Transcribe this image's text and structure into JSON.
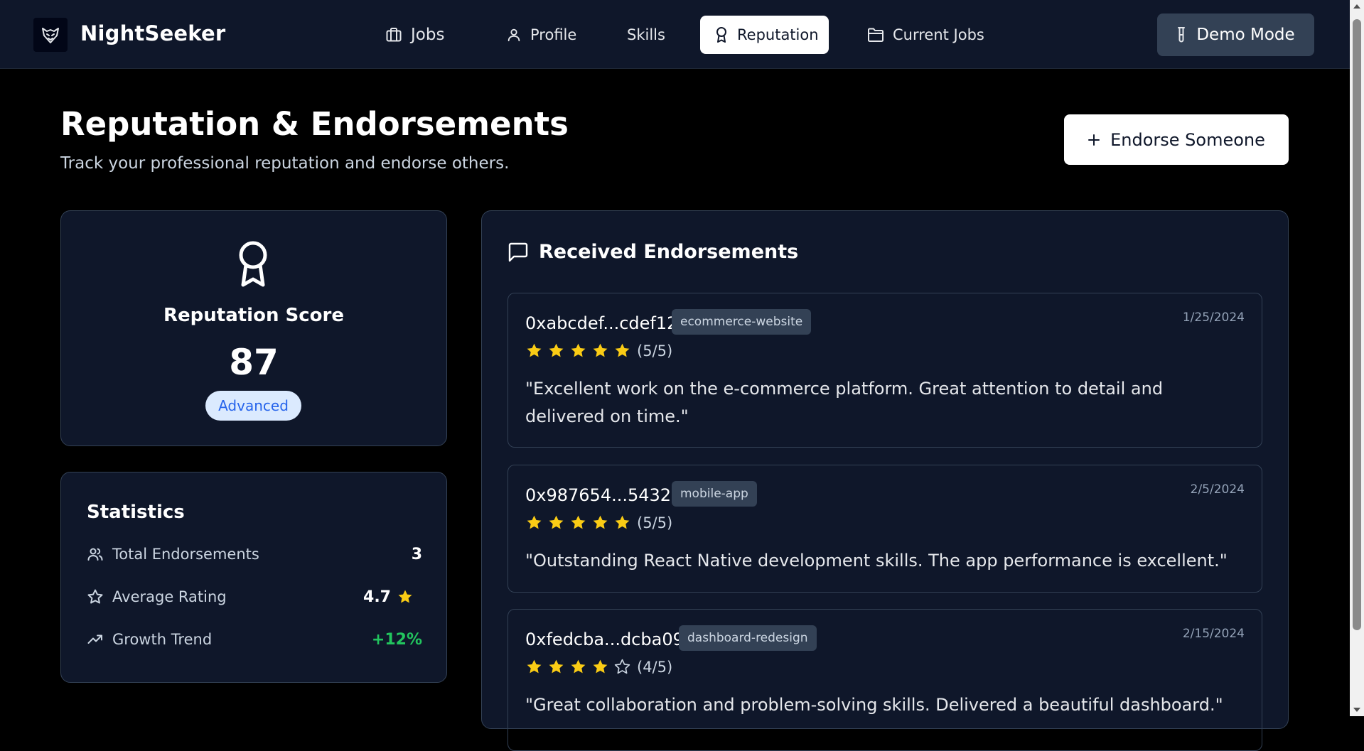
{
  "nav": {
    "brand": "NightSeeker",
    "items": [
      {
        "label": "Jobs",
        "icon": "briefcase-icon"
      },
      {
        "label": "Profile",
        "icon": "user-icon"
      },
      {
        "label": "Skills",
        "icon": ""
      },
      {
        "label": "Reputation",
        "icon": "award-icon",
        "active": true
      },
      {
        "label": "Current Jobs",
        "icon": "folder-icon"
      }
    ],
    "demo_label": "Demo Mode"
  },
  "page": {
    "title": "Reputation & Endorsements",
    "subtitle": "Track your professional reputation and endorse others.",
    "endorse_button": "Endorse Someone"
  },
  "score": {
    "label": "Reputation Score",
    "value": "87",
    "level": "Advanced"
  },
  "statistics": {
    "title": "Statistics",
    "rows": [
      {
        "label": "Total Endorsements",
        "value": "3",
        "icon": "users-icon"
      },
      {
        "label": "Average Rating",
        "value": "4.7",
        "icon": "star-outline-icon"
      },
      {
        "label": "Growth Trend",
        "value": "+12%",
        "icon": "trending-up-icon"
      }
    ]
  },
  "endorsements": {
    "title": "Received Endorsements",
    "items": [
      {
        "address": "0xabcdef...cdef12",
        "tag": "ecommerce-website",
        "date": "1/25/2024",
        "rating": 5,
        "rating_text": "(5/5)",
        "comment": "\"Excellent work on the e-commerce platform. Great attention to detail and delivered on time.\""
      },
      {
        "address": "0x987654...543210",
        "tag": "mobile-app",
        "date": "2/5/2024",
        "rating": 5,
        "rating_text": "(5/5)",
        "comment": "\"Outstanding React Native development skills. The app performance is excellent.\""
      },
      {
        "address": "0xfedcba...dcba09",
        "tag": "dashboard-redesign",
        "date": "2/15/2024",
        "rating": 4,
        "rating_text": "(4/5)",
        "comment": "\"Great collaboration and problem-solving skills. Delivered a beautiful dashboard.\""
      }
    ]
  },
  "colors": {
    "background": "#000000",
    "surface": "#0f172a",
    "star": "#facc15",
    "positive": "#22c55e",
    "badge_text": "#2563eb"
  }
}
